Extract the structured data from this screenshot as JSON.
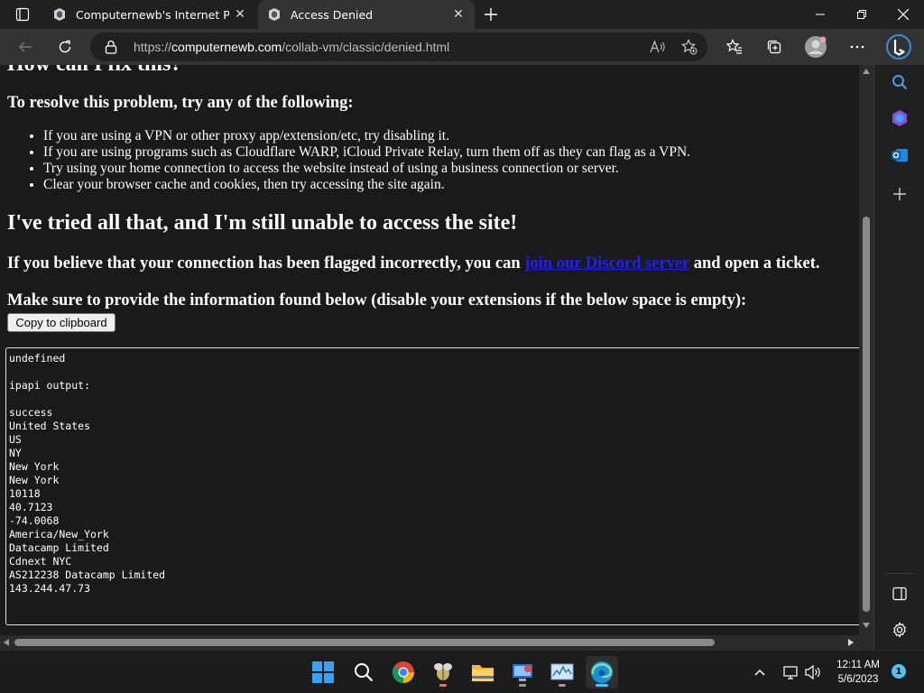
{
  "tabs": [
    {
      "title": "Computernewb's Internet Pub Hu",
      "close": "✕"
    },
    {
      "title": "Access Denied",
      "close": "✕"
    }
  ],
  "url": {
    "scheme": "https://",
    "host": "computernewb.com",
    "path": "/collab-vm/classic/denied.html"
  },
  "page": {
    "cut_heading": "How can I fix this?",
    "resolve_heading": "To resolve this problem, try any of the following:",
    "fixes": [
      "If you are using a VPN or other proxy app/extension/etc, try disabling it.",
      "If you are using programs such as Cloudflare WARP, iCloud Private Relay, turn them off as they can flag as a VPN.",
      "Try using your home connection to access the website instead of using a business connection or server.",
      "Clear your browser cache and cookies, then try accessing the site again."
    ],
    "tried_heading": "I've tried all that, and I'm still unable to access the site!",
    "flagged_before": "If you believe that your connection has been flagged incorrectly, you can ",
    "flagged_link": "join our Discord server",
    "flagged_after": " and open a ticket.",
    "make_sure": "Make sure to provide the information found below (disable your extensions if the below space is empty):",
    "copy_button": "Copy to clipboard",
    "info_lines": [
      "undefined",
      "",
      "ipapi output:",
      "",
      "success",
      "United States",
      "US",
      "NY",
      "New York",
      "New York",
      "10118",
      "40.7123",
      "-74.0068",
      "America/New_York",
      "Datacamp Limited",
      "Cdnext NYC",
      "AS212238 Datacamp Limited",
      "143.244.47.73"
    ]
  },
  "taskbar": {
    "time": "12:11 AM",
    "date": "5/6/2023",
    "notifications": "1"
  },
  "icons": {
    "tab_actions": "tab-actions-icon",
    "favicon": "computernewb-favicon",
    "refresh": "refresh-icon",
    "lock": "lock-icon",
    "read_aloud": "read-aloud-icon",
    "favorite_add": "add-favorite-icon",
    "favorites": "favorites-icon",
    "collections": "collections-icon",
    "profile": "profile-icon",
    "more": "more-icon",
    "bing": "bing-chat-icon"
  },
  "colors": {
    "link": "#2020ee",
    "accent": "#4cc2ff"
  }
}
